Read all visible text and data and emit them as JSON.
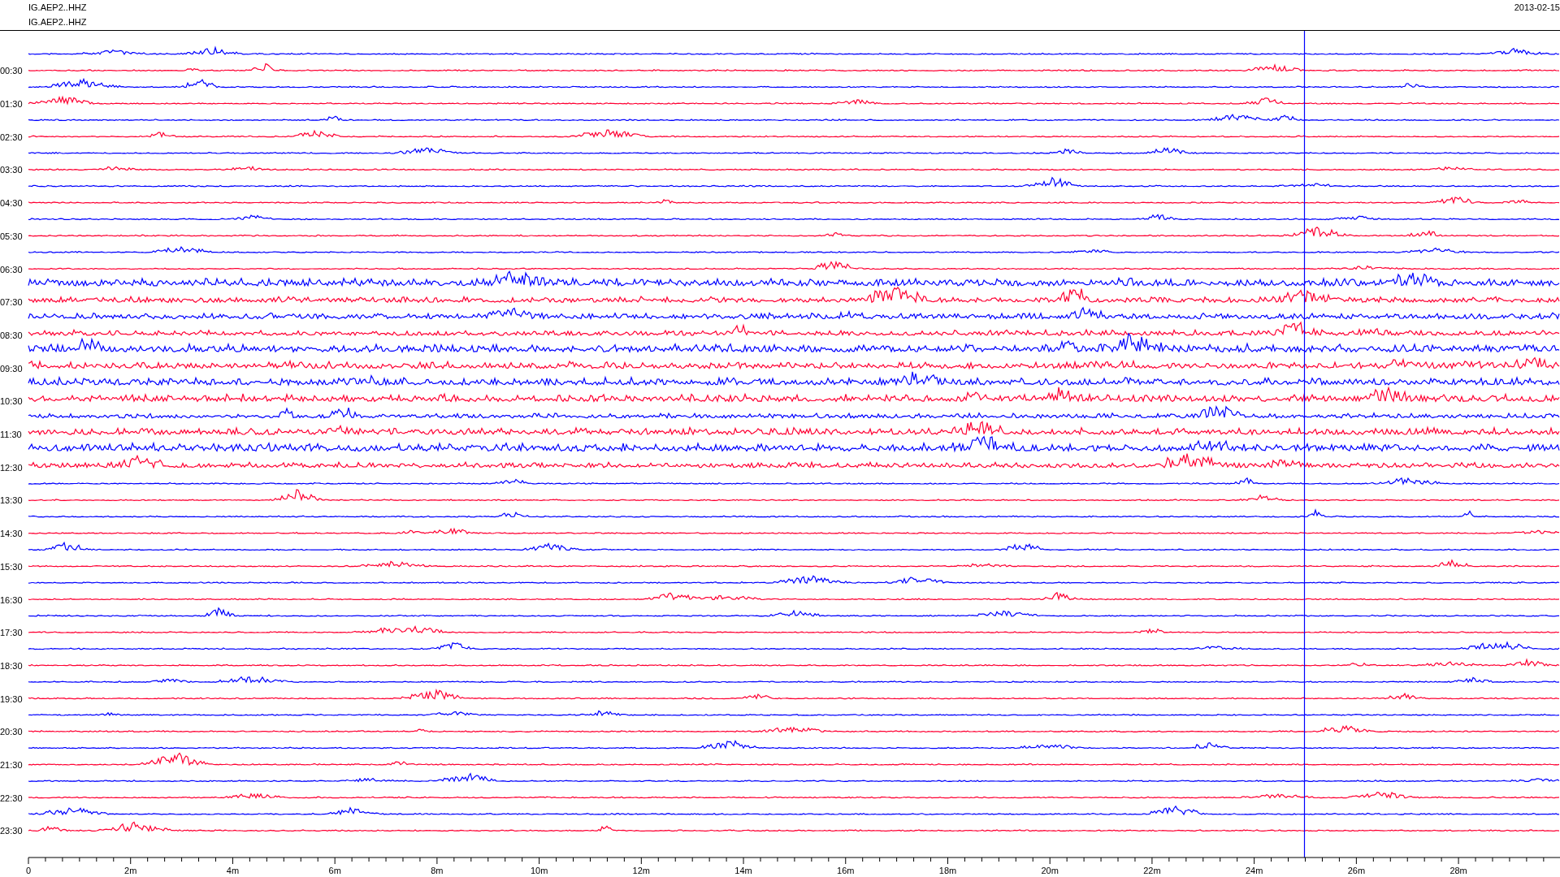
{
  "header": {
    "channel_labels": [
      "IG.AEP2..HHZ",
      "IG.AEP2..HHZ"
    ],
    "date": "2013-02-15"
  },
  "helicorder": {
    "rows": [
      {
        "color": "#0000ff"
      },
      {
        "label": "00:30",
        "color": "#ff0033"
      },
      {
        "color": "#0000ff"
      },
      {
        "label": "01:30",
        "color": "#ff0033"
      },
      {
        "color": "#0000ff"
      },
      {
        "label": "02:30",
        "color": "#ff0033"
      },
      {
        "color": "#0000ff"
      },
      {
        "label": "03:30",
        "color": "#ff0033"
      },
      {
        "color": "#0000ff"
      },
      {
        "label": "04:30",
        "color": "#ff0033"
      },
      {
        "color": "#0000ff"
      },
      {
        "label": "05:30",
        "color": "#ff0033"
      },
      {
        "color": "#0000ff"
      },
      {
        "label": "06:30",
        "color": "#ff0033"
      },
      {
        "color": "#0000ff"
      },
      {
        "label": "07:30",
        "color": "#ff0033"
      },
      {
        "color": "#0000ff"
      },
      {
        "label": "08:30",
        "color": "#ff0033"
      },
      {
        "color": "#0000ff"
      },
      {
        "label": "09:30",
        "color": "#ff0033"
      },
      {
        "color": "#0000ff"
      },
      {
        "label": "10:30",
        "color": "#ff0033"
      },
      {
        "color": "#0000ff"
      },
      {
        "label": "11:30",
        "color": "#ff0033"
      },
      {
        "color": "#0000ff"
      },
      {
        "label": "12:30",
        "color": "#ff0033"
      },
      {
        "color": "#0000ff"
      },
      {
        "label": "13:30",
        "color": "#ff0033"
      },
      {
        "color": "#0000ff"
      },
      {
        "label": "14:30",
        "color": "#ff0033"
      },
      {
        "color": "#0000ff"
      },
      {
        "label": "15:30",
        "color": "#ff0033"
      },
      {
        "color": "#0000ff"
      },
      {
        "label": "16:30",
        "color": "#ff0033"
      },
      {
        "color": "#0000ff"
      },
      {
        "label": "17:30",
        "color": "#ff0033"
      },
      {
        "color": "#0000ff"
      },
      {
        "label": "18:30",
        "color": "#ff0033"
      },
      {
        "color": "#0000ff"
      },
      {
        "label": "19:30",
        "color": "#ff0033"
      },
      {
        "color": "#0000ff"
      },
      {
        "label": "20:30",
        "color": "#ff0033"
      },
      {
        "color": "#0000ff"
      },
      {
        "label": "21:30",
        "color": "#ff0033"
      },
      {
        "color": "#0000ff"
      },
      {
        "label": "22:30",
        "color": "#ff0033"
      },
      {
        "color": "#0000ff"
      },
      {
        "label": "23:30",
        "color": "#ff0033"
      }
    ],
    "x_axis_labels": [
      "0",
      "2m",
      "4m",
      "6m",
      "8m",
      "10m",
      "12m",
      "14m",
      "16m",
      "18m",
      "20m",
      "22m",
      "24m",
      "26m",
      "28m"
    ]
  }
}
